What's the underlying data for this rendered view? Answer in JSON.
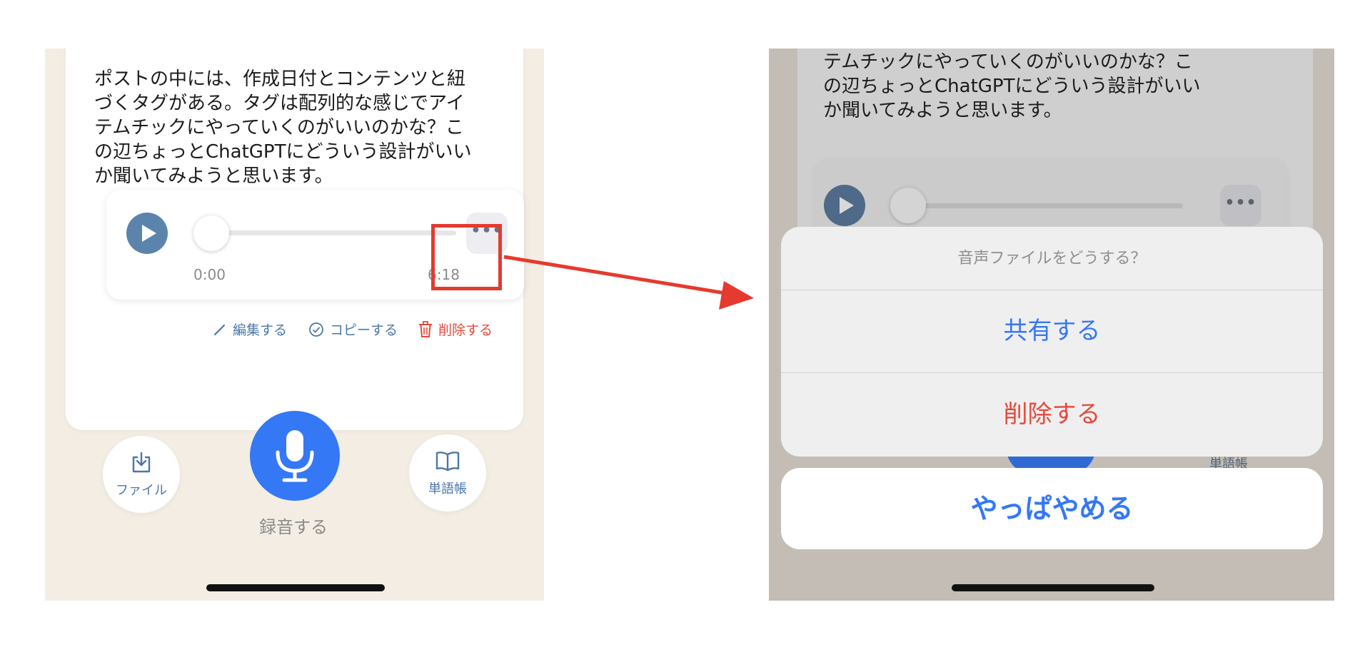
{
  "left_screen": {
    "body_text": "ポストの中には、作成日付とコンテンツと紐\nづくタグがある。タグは配列的な感じでアイ\nテムチックにやっていくのがいいのかな？こ\nの辺ちょっとChatGPTにどういう設計がいい\nか聞いてみようと思います。",
    "player": {
      "time_start": "0:00",
      "time_end": "6:18",
      "progress": 0.0
    },
    "actions": {
      "edit": "編集する",
      "copy": "コピーする",
      "delete": "削除する"
    },
    "bottom_bar": {
      "file": "ファイル",
      "record": "録音する",
      "vocab": "単語帳"
    }
  },
  "right_screen": {
    "body_text": "テムチックにやっていくのがいいのかな？こ\nの辺ちょっとChatGPTにどういう設計がいい\nか聞いてみようと思います。",
    "sheet": {
      "title": "音声ファイルをどうする？",
      "share": "共有する",
      "delete": "削除する",
      "cancel": "やっぱやめる"
    },
    "partial_label": "単語帳"
  },
  "colors": {
    "accent_blue": "#3478f6",
    "destructive_red": "#e8483c",
    "annotation_red": "#e53a2f",
    "play_button": "#5b84ad"
  }
}
